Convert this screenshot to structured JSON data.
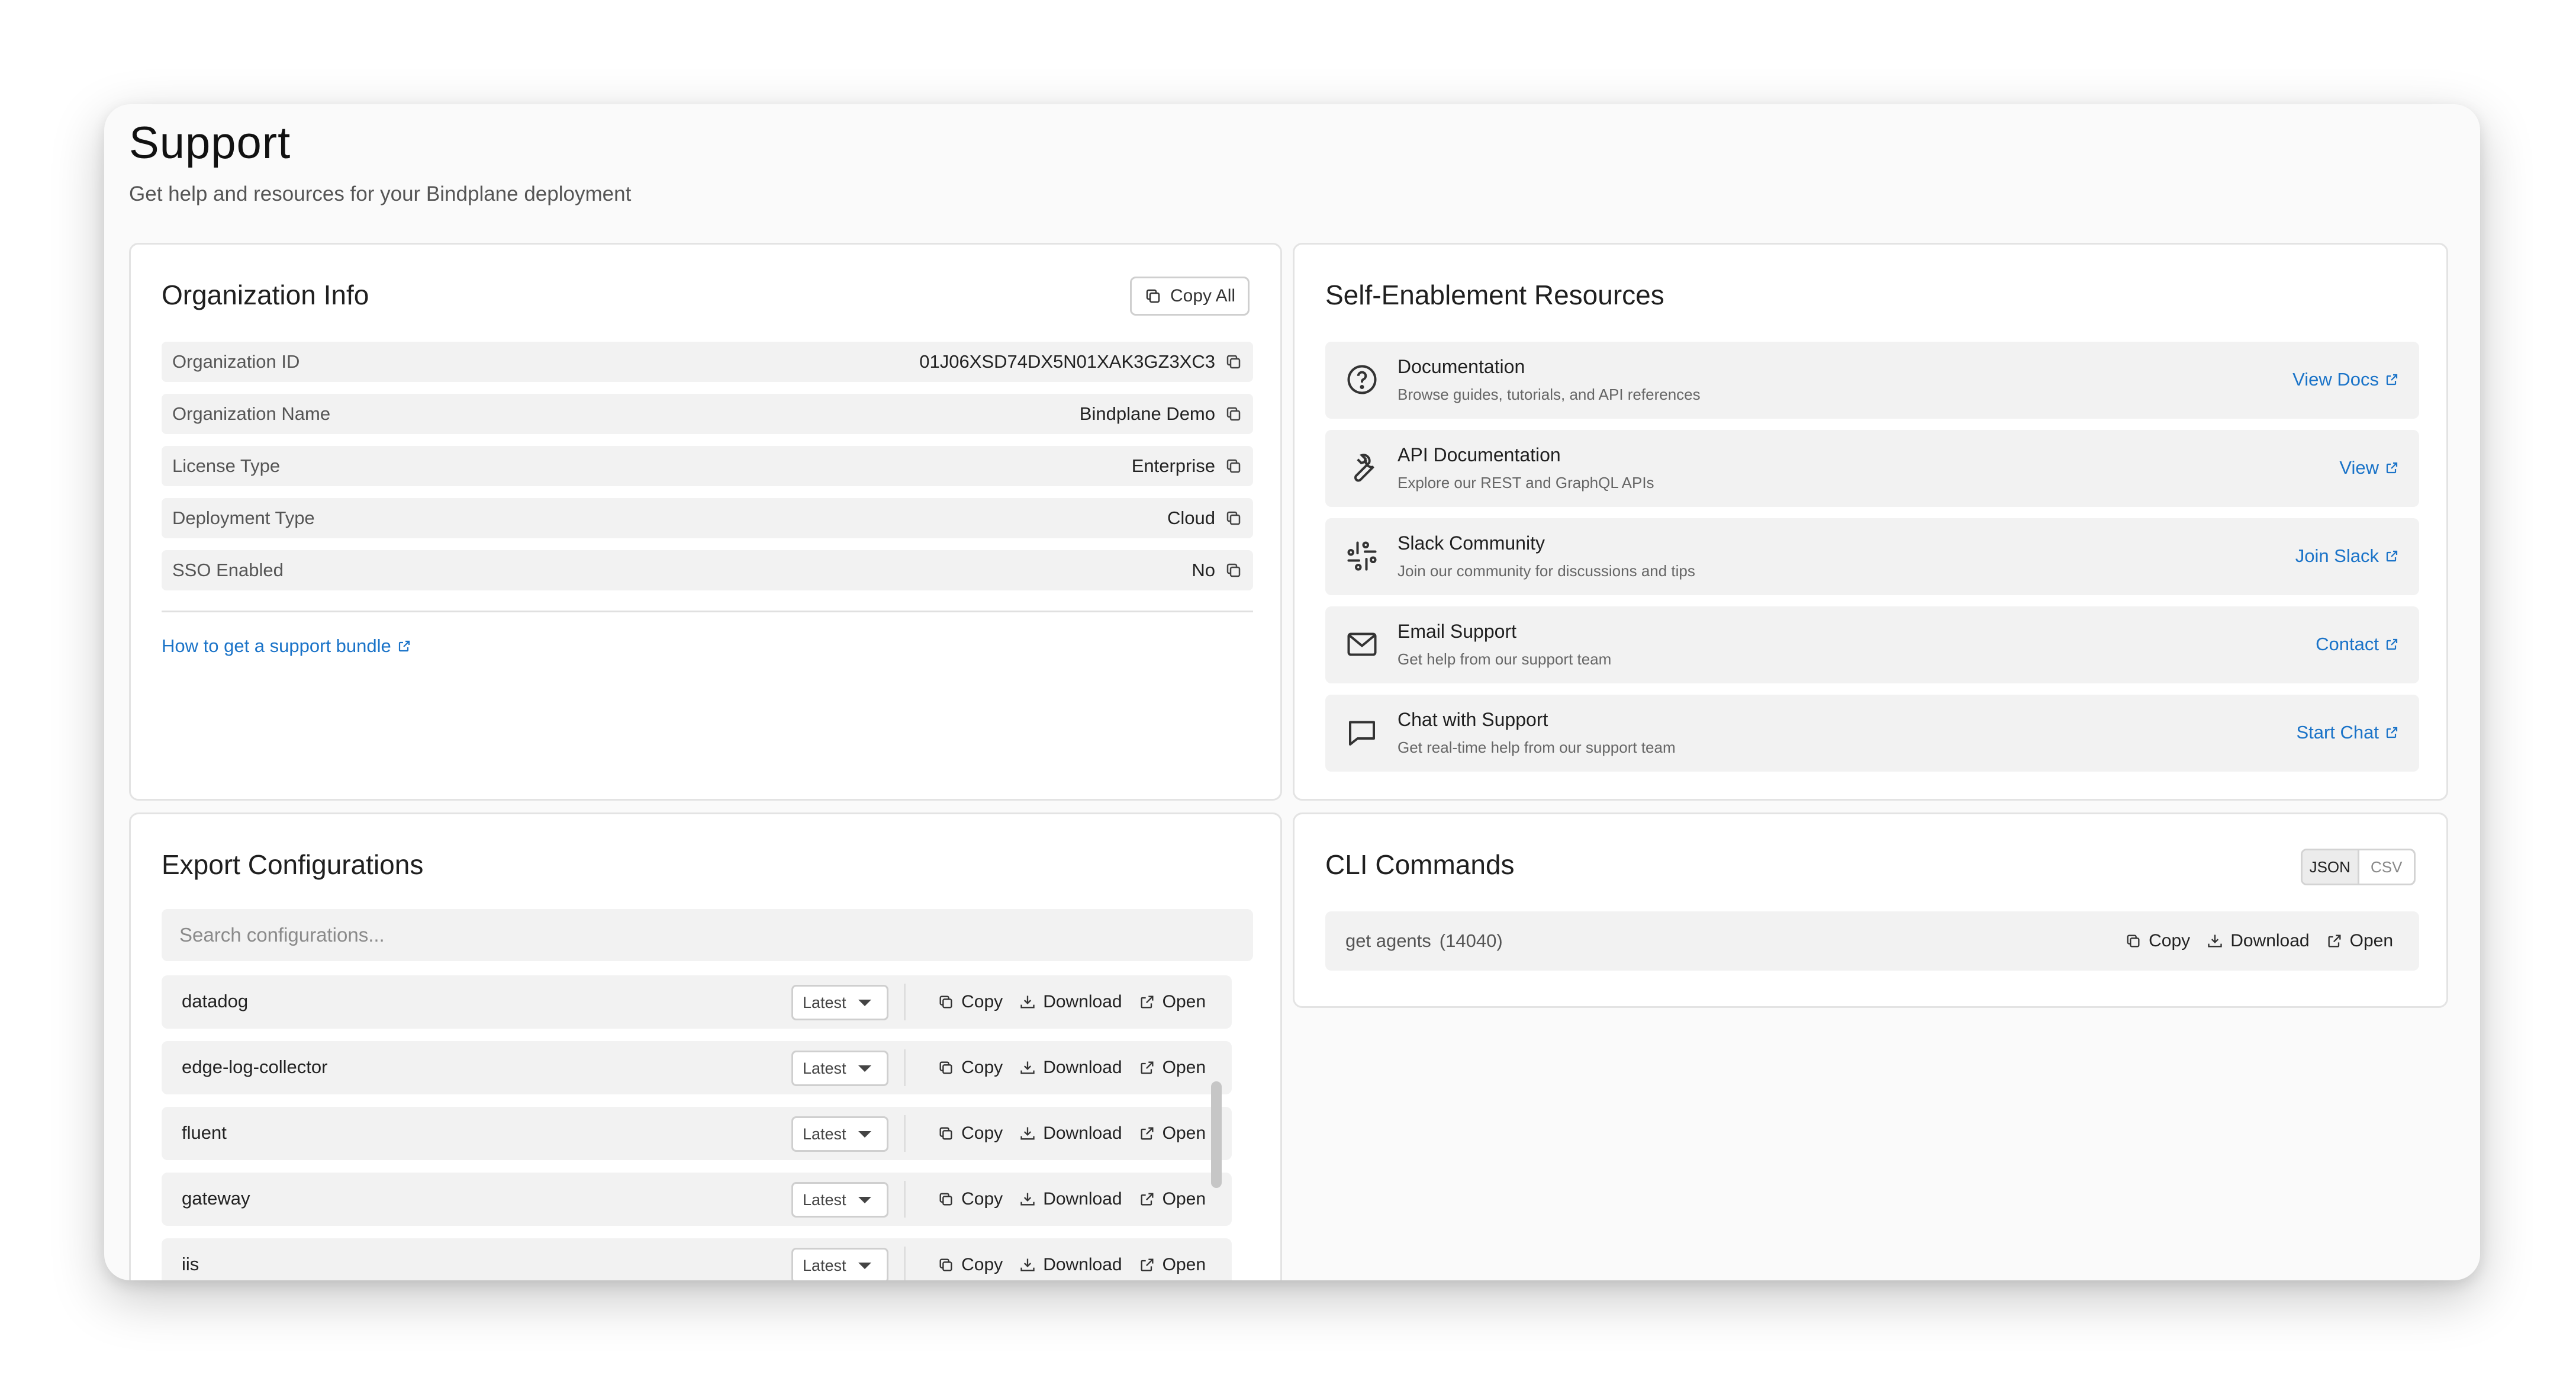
{
  "page": {
    "title": "Support",
    "subtitle": "Get help and resources for your Bindplane deployment"
  },
  "org_info": {
    "title": "Organization Info",
    "copy_all_label": "Copy All",
    "rows": [
      {
        "label": "Organization ID",
        "value": "01J06XSD74DX5N01XAK3GZ3XC3"
      },
      {
        "label": "Organization Name",
        "value": "Bindplane Demo"
      },
      {
        "label": "License Type",
        "value": "Enterprise"
      },
      {
        "label": "Deployment Type",
        "value": "Cloud"
      },
      {
        "label": "SSO Enabled",
        "value": "No"
      }
    ],
    "support_bundle_link": "How to get a support bundle"
  },
  "self_enablement": {
    "title": "Self-Enablement Resources",
    "items": [
      {
        "title": "Documentation",
        "description": "Browse guides, tutorials, and API references",
        "link": "View Docs",
        "icon": "question-circle-icon"
      },
      {
        "title": "API Documentation",
        "description": "Explore our REST and GraphQL APIs",
        "link": "View",
        "icon": "wrench-icon"
      },
      {
        "title": "Slack Community",
        "description": "Join our community for discussions and tips",
        "link": "Join Slack",
        "icon": "slack-icon"
      },
      {
        "title": "Email Support",
        "description": "Get help from our support team",
        "link": "Contact",
        "icon": "mail-icon"
      },
      {
        "title": "Chat with Support",
        "description": "Get real-time help from our support team",
        "link": "Start Chat",
        "icon": "chat-bubble-icon"
      }
    ]
  },
  "export_configs": {
    "title": "Export Configurations",
    "search_placeholder": "Search configurations...",
    "version_label": "Latest",
    "actions": {
      "copy": "Copy",
      "download": "Download",
      "open": "Open"
    },
    "rows": [
      {
        "name": "datadog"
      },
      {
        "name": "edge-log-collector"
      },
      {
        "name": "fluent"
      },
      {
        "name": "gateway"
      },
      {
        "name": "iis"
      }
    ]
  },
  "cli_commands": {
    "title": "CLI Commands",
    "formats": [
      "JSON",
      "CSV"
    ],
    "selected_format": "JSON",
    "command": "get agents",
    "count": "(14040)",
    "actions": {
      "copy": "Copy",
      "download": "Download",
      "open": "Open"
    }
  },
  "colors": {
    "link": "#1a73c8",
    "window_bg": "#fafafa",
    "row_bg": "#f2f2f2"
  }
}
